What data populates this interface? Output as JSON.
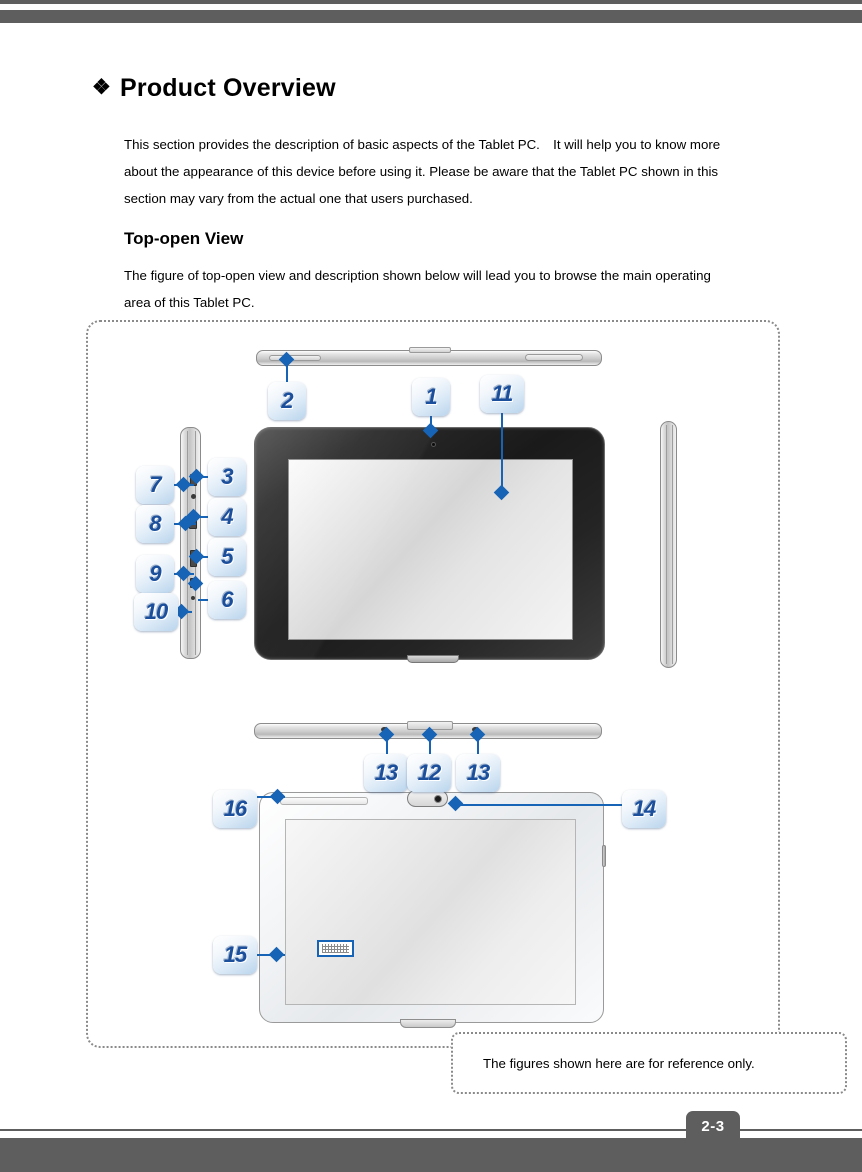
{
  "document": {
    "page_number": "2-3",
    "title": "Product Overview",
    "title_bullet": "❖",
    "intro_paragraph": "This section provides the description of basic aspects of the Tablet PC. It will help you to know more about the appearance of this device before using it. Please be aware that the Tablet PC shown in this section may vary from the actual one that users purchased.",
    "subsection_title": "Top-open View",
    "subsection_paragraph": "The figure of top-open view and description shown below will lead you to browse the main operating area of this Tablet PC.",
    "reference_note": "The figures shown here are for reference only."
  },
  "figure": {
    "callouts": [
      {
        "id": "callout-1",
        "label": "1"
      },
      {
        "id": "callout-2",
        "label": "2"
      },
      {
        "id": "callout-3",
        "label": "3"
      },
      {
        "id": "callout-4",
        "label": "4"
      },
      {
        "id": "callout-5",
        "label": "5"
      },
      {
        "id": "callout-6",
        "label": "6"
      },
      {
        "id": "callout-7",
        "label": "7"
      },
      {
        "id": "callout-8",
        "label": "8"
      },
      {
        "id": "callout-9",
        "label": "9"
      },
      {
        "id": "callout-10",
        "label": "10"
      },
      {
        "id": "callout-11",
        "label": "11"
      },
      {
        "id": "callout-12",
        "label": "12"
      },
      {
        "id": "callout-13a",
        "label": "13"
      },
      {
        "id": "callout-13b",
        "label": "13"
      },
      {
        "id": "callout-14",
        "label": "14"
      },
      {
        "id": "callout-15",
        "label": "15"
      },
      {
        "id": "callout-16",
        "label": "16"
      }
    ]
  },
  "colors": {
    "callout_line": "#1763b5",
    "callout_text": "#1b4f9c",
    "bar_gray": "#5e5e5e",
    "frame_dotted": "#8a8a8a"
  }
}
